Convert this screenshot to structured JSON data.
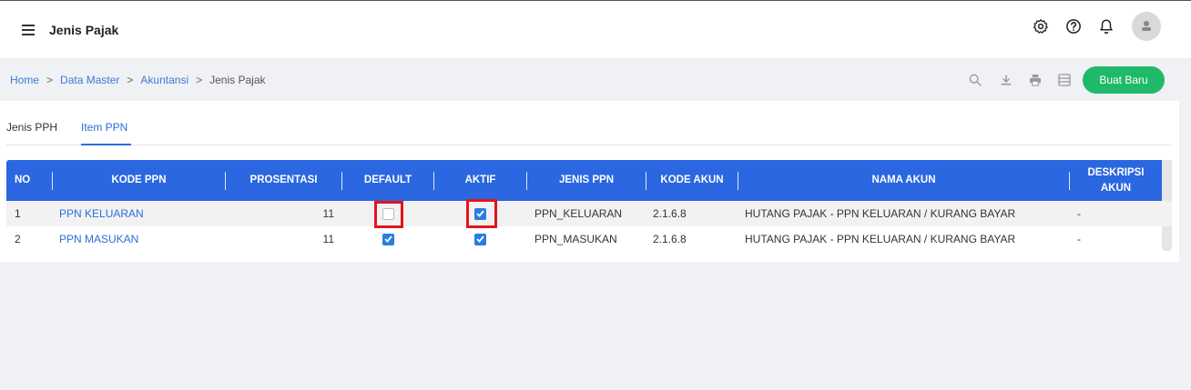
{
  "header": {
    "title": "Jenis Pajak",
    "icons": [
      "settings-icon",
      "help-icon",
      "bell-icon",
      "avatar"
    ]
  },
  "breadcrumb": {
    "items": [
      "Home",
      "Data Master",
      "Akuntansi"
    ],
    "current": "Jenis Pajak",
    "separator": ">"
  },
  "toolbar": {
    "icons": [
      "search-icon",
      "download-icon",
      "print-icon",
      "columns-icon"
    ],
    "new_button": "Buat Baru"
  },
  "tabs": [
    {
      "label": "Jenis PPH",
      "active": false
    },
    {
      "label": "Item PPN",
      "active": true
    }
  ],
  "table": {
    "headers": {
      "no": "NO",
      "kode": "KODE PPN",
      "prosentasi": "PROSENTASI",
      "default": "DEFAULT",
      "aktif": "AKTIF",
      "jenis": "JENIS PPN",
      "kode_akun": "KODE AKUN",
      "nama_akun": "NAMA AKUN",
      "deskripsi_1": "DESKRIPSI",
      "deskripsi_2": "AKUN"
    },
    "rows": [
      {
        "no": "1",
        "kode": "PPN KELUARAN",
        "prosentasi": "11",
        "default": false,
        "aktif": true,
        "jenis": "PPN_KELUARAN",
        "kode_akun": "2.1.6.8",
        "nama_akun": "HUTANG PAJAK - PPN KELUARAN / KURANG BAYAR",
        "deskripsi": "-"
      },
      {
        "no": "2",
        "kode": "PPN MASUKAN",
        "prosentasi": "11",
        "default": true,
        "aktif": true,
        "jenis": "PPN_MASUKAN",
        "kode_akun": "2.1.6.8",
        "nama_akun": "HUTANG PAJAK - PPN KELUARAN / KURANG BAYAR",
        "deskripsi": "-"
      }
    ]
  },
  "colors": {
    "accent": "#2a67e0",
    "link": "#2a6fdb",
    "primary_button": "#1fba68",
    "highlight": "#e1151c"
  }
}
